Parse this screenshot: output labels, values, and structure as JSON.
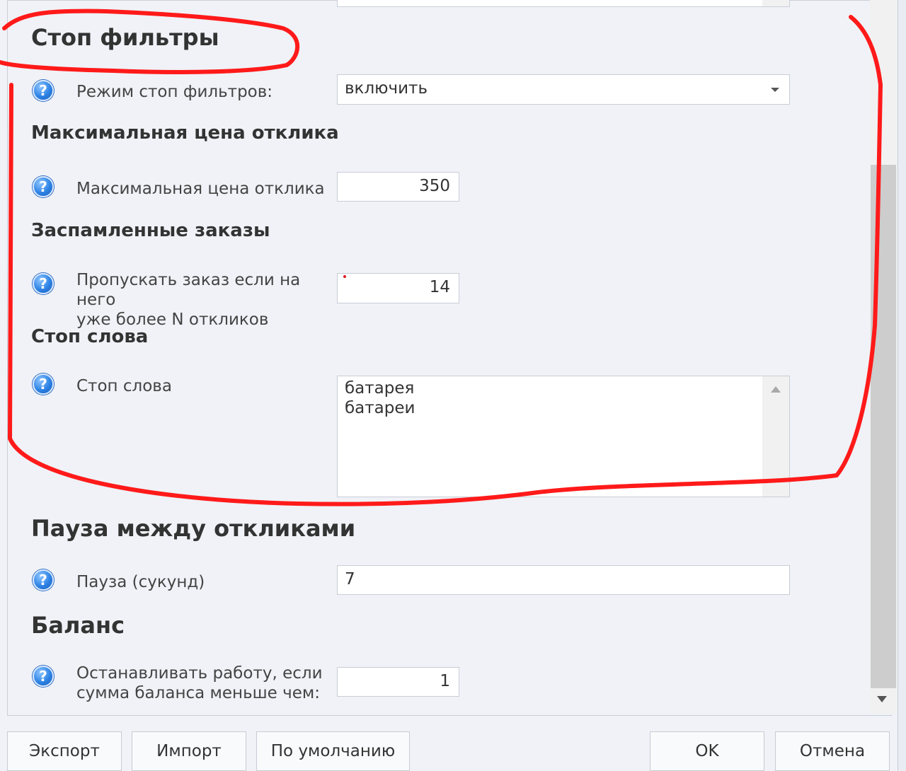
{
  "sections": {
    "stop_filters": {
      "title": "Стоп фильтры",
      "mode_label": "Режим стоп фильтров:",
      "mode_value": "включить"
    },
    "max_price": {
      "title": "Максимальная цена отклика",
      "label": "Максимальная цена отклика",
      "value": "350"
    },
    "spammed": {
      "title": "Заспамленные заказы",
      "label_line1": "Пропускать заказ если на него",
      "label_line2": "уже более N откликов",
      "value": "14"
    },
    "stop_words": {
      "title": "Стоп слова",
      "label": "Стоп слова",
      "lines": [
        "батарея",
        "батареи"
      ]
    },
    "pause": {
      "title": "Пауза между откликами",
      "label": "Пауза (сукунд)",
      "value": "7"
    },
    "balance": {
      "title": "Баланс",
      "label_line1": "Останавливать работу, если",
      "label_line2": "сумма баланса меньше чем:",
      "value": "1"
    }
  },
  "help_icon_glyph": "?",
  "buttons": {
    "export": "Экспорт",
    "import": "Импорт",
    "default": "По умолчанию",
    "ok": "OK",
    "cancel": "Отмена"
  },
  "colors": {
    "annotation": "#ff1a1a",
    "help_icon": "#2d83e5",
    "panel_bg": "#f0f2f7"
  }
}
